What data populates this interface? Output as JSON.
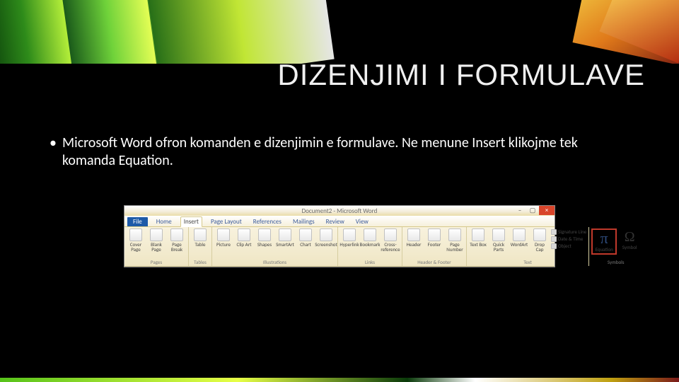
{
  "slide": {
    "title": "DIZENJIMI I FORMULAVE",
    "bullet1": "Microsoft Word ofron komanden e dizenjimin e formulave. Ne menune Insert klikojme tek komanda Equation."
  },
  "word": {
    "title": "Document2 - Microsoft Word",
    "file_tab": "File",
    "tabs": {
      "home": "Home",
      "insert": "Insert",
      "page_layout": "Page Layout",
      "references": "References",
      "mailings": "Mailings",
      "review": "Review",
      "view": "View"
    },
    "close": "×",
    "min": "–",
    "max": "▢",
    "groups": {
      "pages": {
        "label": "Pages",
        "cover": "Cover Page",
        "blank": "Blank Page",
        "break": "Page Break"
      },
      "tables": {
        "label": "Tables",
        "table": "Table"
      },
      "illustrations": {
        "label": "Illustrations",
        "picture": "Picture",
        "clipart": "Clip Art",
        "shapes": "Shapes",
        "smartart": "SmartArt",
        "chart": "Chart",
        "screenshot": "Screenshot"
      },
      "links": {
        "label": "Links",
        "hyperlink": "Hyperlink",
        "bookmark": "Bookmark",
        "crossref": "Cross-reference"
      },
      "hf": {
        "label": "Header & Footer",
        "header": "Header",
        "footer": "Footer",
        "pagenum": "Page Number"
      },
      "text": {
        "label": "Text",
        "textbox": "Text Box",
        "quick": "Quick Parts",
        "wordart": "WordArt",
        "dropcap": "Drop Cap",
        "sig": "Signature Line",
        "date": "Date & Time",
        "obj": "Object"
      },
      "symbols": {
        "label": "Symbols",
        "equation": "Equation",
        "symbol": "Symbol"
      }
    }
  }
}
